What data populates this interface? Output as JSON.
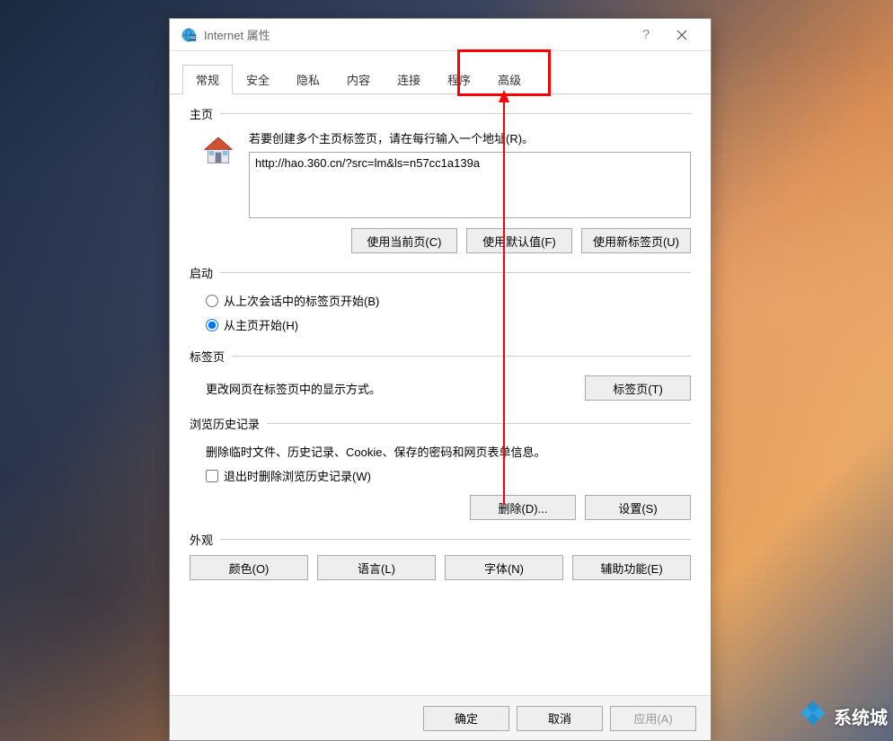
{
  "titlebar": {
    "title": "Internet 属性",
    "help": "?"
  },
  "tabs": [
    "常规",
    "安全",
    "隐私",
    "内容",
    "连接",
    "程序",
    "高级"
  ],
  "active_tab_index": 0,
  "highlighted_tab_index": 6,
  "homepage": {
    "label": "主页",
    "hint": "若要创建多个主页标签页，请在每行输入一个地址(R)。",
    "value": "http://hao.360.cn/?src=lm&ls=n57cc1a139a",
    "buttons": {
      "current": "使用当前页(C)",
      "default": "使用默认值(F)",
      "newtab": "使用新标签页(U)"
    }
  },
  "startup": {
    "label": "启动",
    "opt_last": "从上次会话中的标签页开始(B)",
    "opt_home": "从主页开始(H)",
    "selected": "home"
  },
  "tabsection": {
    "label": "标签页",
    "text": "更改网页在标签页中的显示方式。",
    "button": "标签页(T)"
  },
  "history": {
    "label": "浏览历史记录",
    "text": "删除临时文件、历史记录、Cookie、保存的密码和网页表单信息。",
    "check_label": "退出时删除浏览历史记录(W)",
    "checked": false,
    "delete_btn": "删除(D)...",
    "settings_btn": "设置(S)"
  },
  "appearance": {
    "label": "外观",
    "colors": "颜色(O)",
    "language": "语言(L)",
    "fonts": "字体(N)",
    "accessibility": "辅助功能(E)"
  },
  "footer": {
    "ok": "确定",
    "cancel": "取消",
    "apply": "应用(A)"
  },
  "watermark": "系统城"
}
